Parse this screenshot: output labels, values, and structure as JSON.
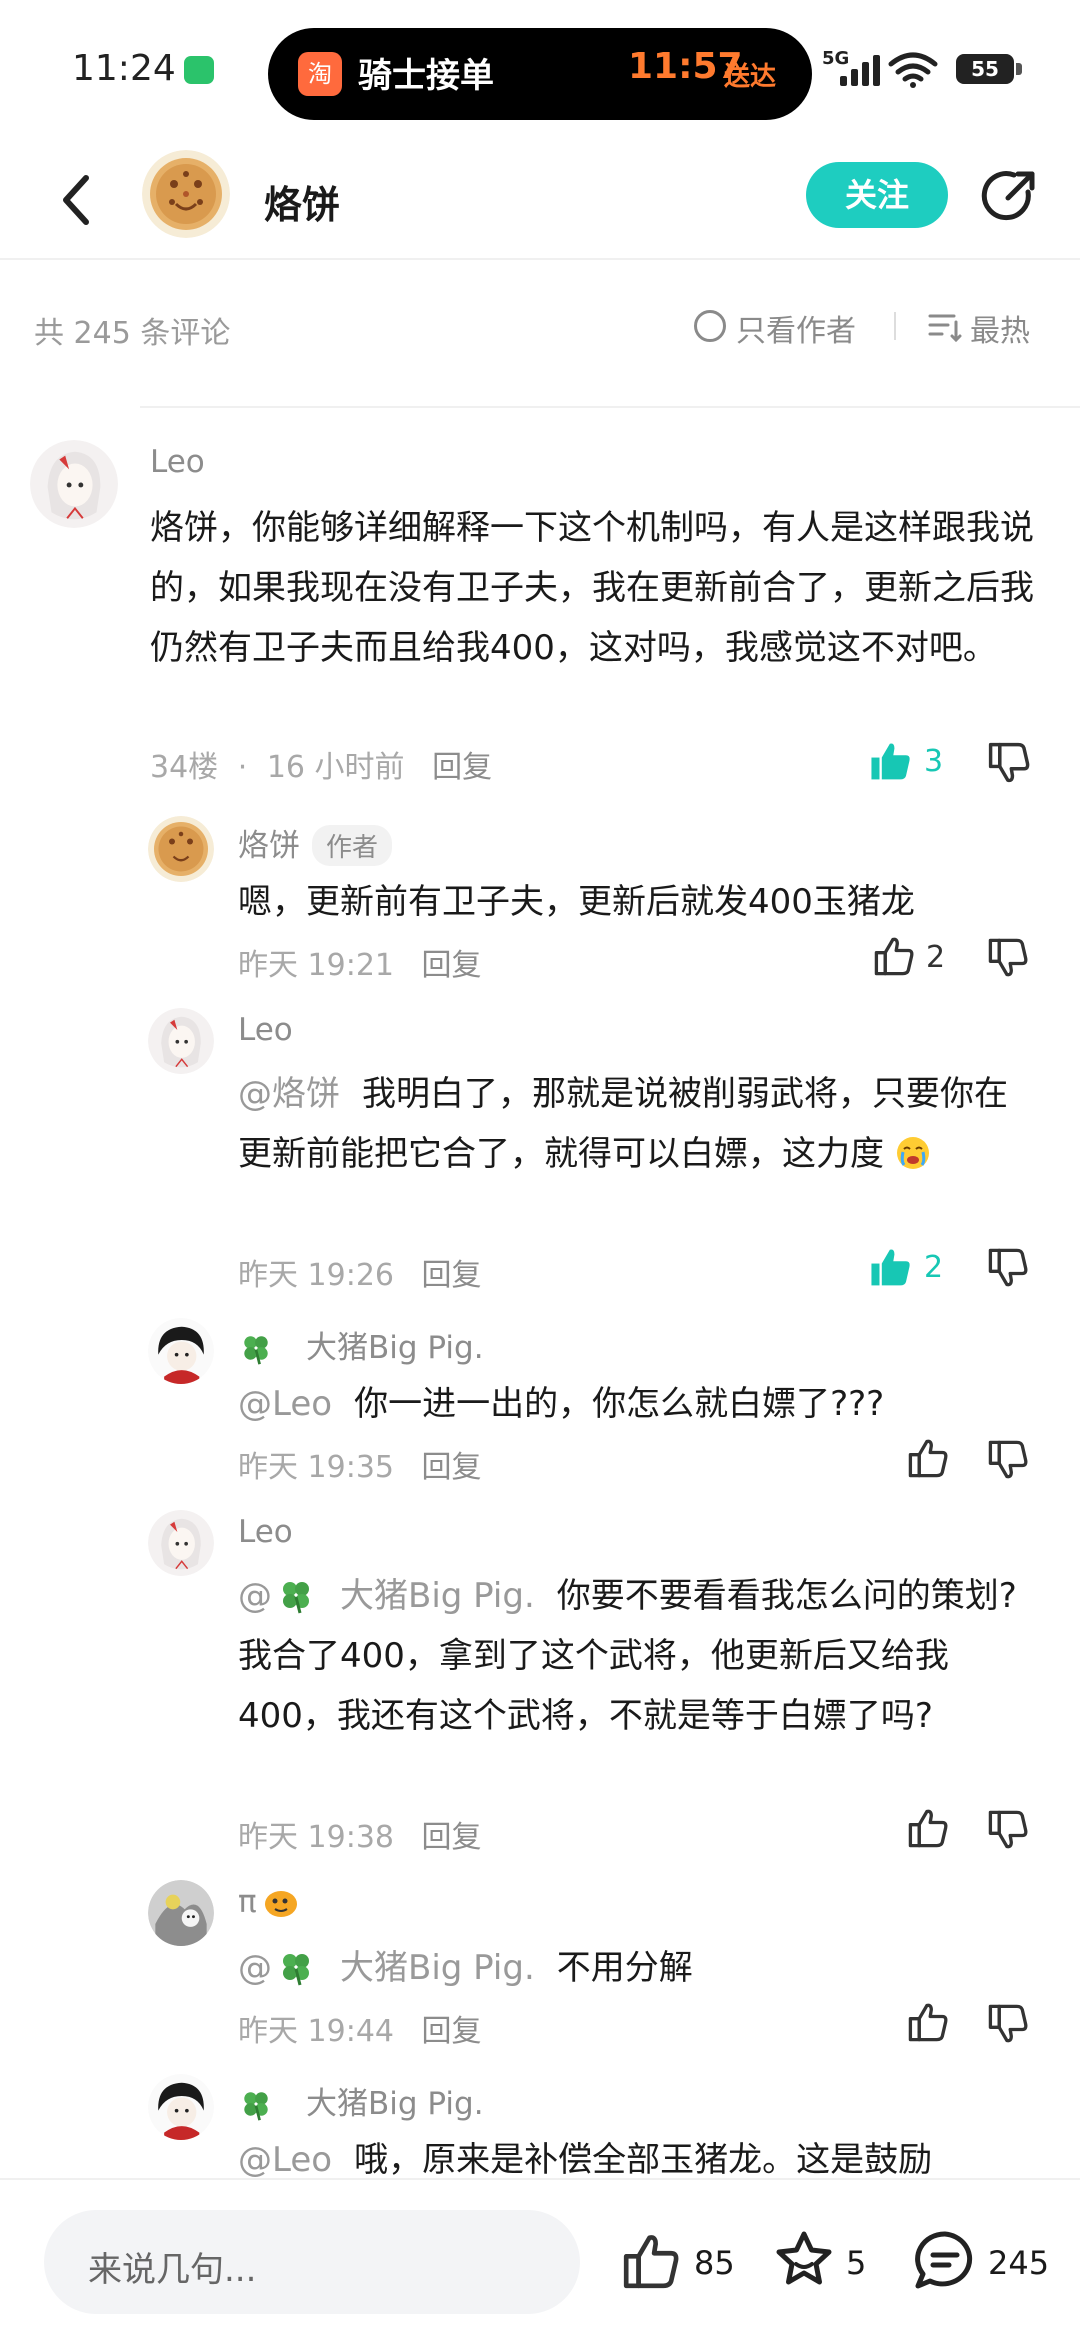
{
  "status_bar": {
    "time": "11:24",
    "island_app_icon": "淘",
    "island_title": "骑士接单",
    "island_time": "11:57",
    "island_status": "送达",
    "network": "5G",
    "battery": "55"
  },
  "header": {
    "name": "烙饼",
    "follow_label": "关注"
  },
  "filter": {
    "count_text": "共 245 条评论",
    "author_only_label": "只看作者",
    "sort_label": "最热"
  },
  "comments": [
    {
      "name": "Leo",
      "text": "烙饼，你能够详细解释一下这个机制吗，有人是这样跟我说的，如果我现在没有卫子夫，我在更新前合了，更新之后我仍然有卫子夫而且给我400，这对吗，我感觉这不对吧。",
      "floor": "34楼",
      "sep": "·",
      "time": "16 小时前",
      "reply_label": "回复",
      "likes": "3",
      "liked": true
    },
    {
      "name": "烙饼",
      "badge": "作者",
      "text": "嗯，更新前有卫子夫，更新后就发400玉猪龙",
      "time": "昨天 19:21",
      "reply_label": "回复",
      "likes": "2",
      "liked": false
    },
    {
      "name": "Leo",
      "mention": "@烙饼",
      "text": "我明白了，那就是说被削弱武将，只要你在更新前能把它合了，就得可以白嫖，这力度",
      "time": "昨天 19:26",
      "reply_label": "回复",
      "likes": "2",
      "liked": true
    },
    {
      "name": "大猪Big Pig.",
      "mention": "@Leo",
      "text": "你一进一出的，你怎么就白嫖了???",
      "time": "昨天 19:35",
      "reply_label": "回复",
      "likes": "",
      "liked": false
    },
    {
      "name": "Leo",
      "mention": "@",
      "mention_name": "大猪Big Pig.",
      "text": "你要不要看看我怎么问的策划? 我合了400，拿到了这个武将，他更新后又给我400，我还有这个武将，不就是等于白嫖了吗?",
      "time": "昨天 19:38",
      "reply_label": "回复",
      "likes": "",
      "liked": false
    },
    {
      "name": "π",
      "mention": "@",
      "mention_name": "大猪Big Pig.",
      "text": "不用分解",
      "time": "昨天 19:44",
      "reply_label": "回复",
      "likes": "",
      "liked": false
    },
    {
      "name": "大猪Big Pig.",
      "mention": "@Leo",
      "text": "哦，原来是补偿全部玉猪龙。这是鼓励"
    }
  ],
  "bottom_bar": {
    "input_placeholder": "来说几句...",
    "likes": "85",
    "favorites": "5",
    "comments": "245"
  },
  "colors": {
    "accent": "#1ecdc0",
    "liked": "#17c7b4"
  }
}
